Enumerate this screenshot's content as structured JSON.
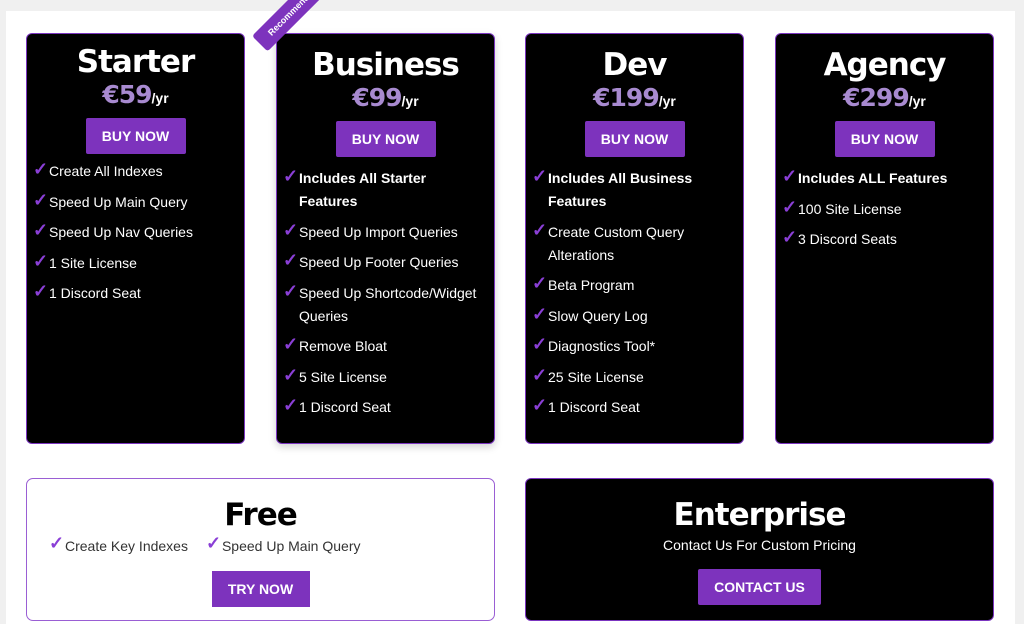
{
  "accent_color": "#7d33bd",
  "price_color": "#a88ad0",
  "plans": [
    {
      "name": "Starter",
      "price": "€59",
      "period": "/yr",
      "button": "BUY NOW",
      "features": [
        {
          "text": "Create All Indexes",
          "bold": false
        },
        {
          "text": "Speed Up Main Query",
          "bold": false
        },
        {
          "text": "Speed Up Nav Queries",
          "bold": false
        },
        {
          "text": "1 Site License",
          "bold": false
        },
        {
          "text": "1 Discord Seat",
          "bold": false
        }
      ]
    },
    {
      "name": "Business",
      "badge": "Recommended",
      "price": "€99",
      "period": "/yr",
      "button": "BUY NOW",
      "features": [
        {
          "text": "Includes All Starter Features",
          "bold": true
        },
        {
          "text": "Speed Up Import Queries",
          "bold": false
        },
        {
          "text": "Speed Up Footer Queries",
          "bold": false
        },
        {
          "text": "Speed Up Shortcode/Widget Queries",
          "bold": false
        },
        {
          "text": "Remove Bloat",
          "bold": false
        },
        {
          "text": "5 Site License",
          "bold": false
        },
        {
          "text": "1 Discord Seat",
          "bold": false
        }
      ]
    },
    {
      "name": "Dev",
      "price": "€199",
      "period": "/yr",
      "button": "BUY NOW",
      "features": [
        {
          "text": "Includes All Business Features",
          "bold": true
        },
        {
          "text": "Create Custom Query Alterations",
          "bold": false
        },
        {
          "text": "Beta Program",
          "bold": false
        },
        {
          "text": "Slow Query Log",
          "bold": false
        },
        {
          "text": "Diagnostics Tool*",
          "bold": false
        },
        {
          "text": "25 Site License",
          "bold": false
        },
        {
          "text": "1 Discord Seat",
          "bold": false
        }
      ]
    },
    {
      "name": "Agency",
      "price": "€299",
      "period": "/yr",
      "button": "BUY NOW",
      "features": [
        {
          "text": "Includes ALL Features",
          "bold": true
        },
        {
          "text": "100 Site License",
          "bold": false
        },
        {
          "text": "3 Discord Seats",
          "bold": false
        }
      ]
    }
  ],
  "free": {
    "name": "Free",
    "features": [
      "Create Key Indexes",
      "Speed Up Main Query"
    ],
    "button": "TRY NOW"
  },
  "enterprise": {
    "name": "Enterprise",
    "subtitle": "Contact Us For Custom Pricing",
    "button": "CONTACT US"
  },
  "check_icon": "✓"
}
